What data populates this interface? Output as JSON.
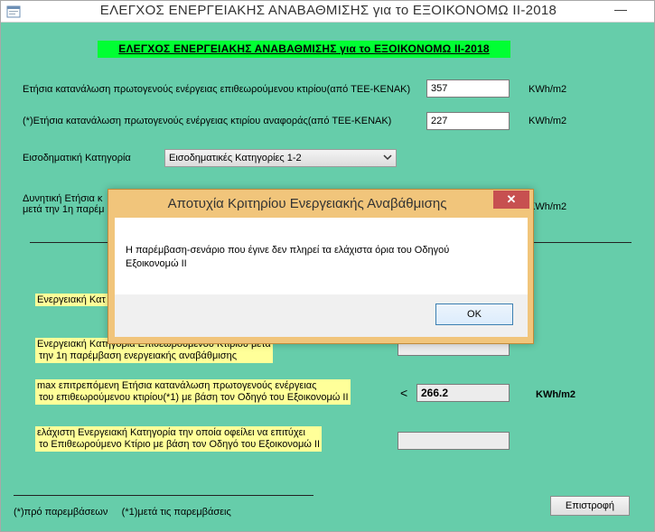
{
  "window": {
    "title": "ΕΛΕΓΧΟΣ ΕΝΕΡΓΕΙΑΚΗΣ ΑΝΑΒΑΘΜΙΣΗΣ για το ΕΞΟΙΚΟΝΟΜΩ ΙΙ-2018",
    "minimize_glyph": "—",
    "icon": "app-form-icon"
  },
  "form": {
    "header": "ΕΛΕΓΧΟΣ ΕΝΕΡΓΕΙΑΚΗΣ ΑΝΑΒΑΘΜΙΣΗΣ για το ΕΞΟΙΚΟΝΟΜΩ ΙΙ-2018",
    "inspected_consumption": {
      "label": "Ετήσια κατανάλωση πρωτογενούς  ενέργειας επιθεωρούμενου κτιρίου(από ΤΕΕ-ΚΕΝΑΚ)",
      "value": "357",
      "unit": "KWh/m2"
    },
    "reference_consumption": {
      "label": "(*)Ετήσια κατανάλωση πρωτογενούς  ενέργειας  κτιρίου αναφοράς(από ΤΕΕ-ΚΕΝΑΚ)",
      "value": "227",
      "unit": "KWh/m2"
    },
    "income_category": {
      "label": "Εισοδηματική Κατηγορία",
      "selected": "Εισοδηματικές Κατηγορίες 1-2"
    },
    "potential_consumption": {
      "label_line1": "Δυνητική Ετήσια κ",
      "label_line2": "μετά  την  1η παρέμ",
      "unit": "KWh/m2"
    },
    "energy_category_before": {
      "label": "Ενεργειακή Κατ"
    },
    "energy_category_after": {
      "label_line1": "Ενεργειακή Κατηγορία Επιθεωρούμενου Κτιρίου μετά",
      "label_line2": "την  1η παρέμβαση ενεργειακής αναβάθμισης"
    },
    "max_allowed": {
      "label_line1": "max επιτρεπόμενη Ετήσια κατανάλωση πρωτογενούς  ενέργειας",
      "label_line2": "του επιθεωρούμενου κτιρίου(*1) με βάση τον Οδηγό του Εξοικονομώ ΙΙ",
      "comparator": "<",
      "value": "266.2",
      "unit": "KWh/m2"
    },
    "min_category": {
      "label_line1": "ελάχιστη Ενεργειακή Κατηγορία την οποία οφείλει να επιτύχει",
      "label_line2": "το Επιθεωρούμενο Κτίριο με βάση τον Οδηγό του Εξοικονομώ ΙΙ"
    },
    "footnote": "(*)πρό παρεμβάσεων     (*1)μετά τις παρεμβάσεις",
    "return_button": "Επιστροφή"
  },
  "dialog": {
    "title": "Αποτυχία Κριτηρίου Ενεργειακής Αναβάθμισης",
    "close_glyph": "✕",
    "message_line1": "Η παρέμβαση-σενάριο που έγινε δεν πληρεί τα ελάχιστα όρια του Οδηγού",
    "message_line2": "Εξοικονομώ ΙΙ",
    "ok_label": "OK"
  }
}
